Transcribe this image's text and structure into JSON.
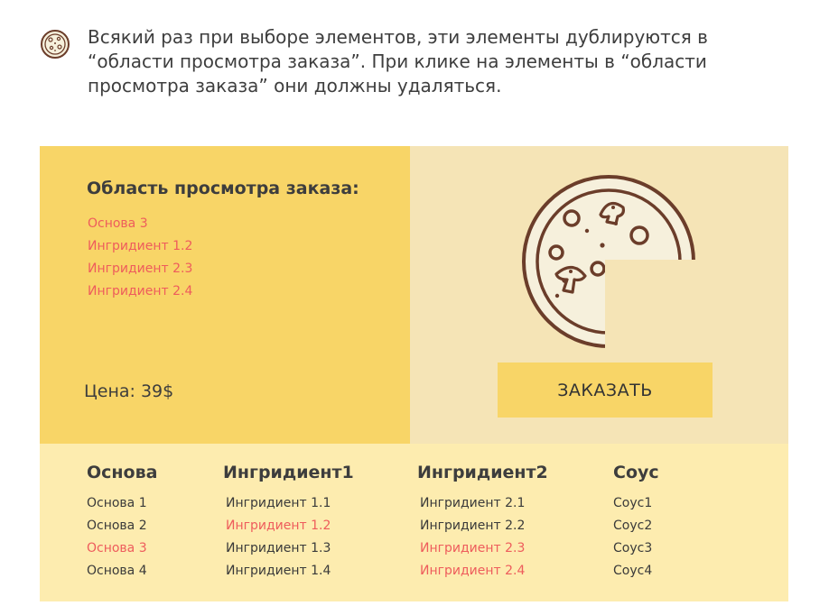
{
  "intro": {
    "icon": "pizza-icon",
    "text": "Всякий раз при выборе элементов, эти элементы дублируются в “области просмотра заказа”. При клике на элементы в “области просмотра заказа” они должны удаляться."
  },
  "preview": {
    "title": "Область просмотра заказа:",
    "items": [
      "Основа 3",
      "Ингридиент 1.2",
      "Ингридиент 2.3",
      "Ингридиент 2.4"
    ],
    "price": "Цена: 39$"
  },
  "pizza_panel": {
    "icon": "pizza-slice-missing-icon",
    "order_button": "ЗАКАЗАТЬ"
  },
  "options": {
    "columns": [
      {
        "title": "Основа",
        "items": [
          {
            "label": "Основа 1",
            "selected": false
          },
          {
            "label": "Основа 2",
            "selected": false
          },
          {
            "label": "Основа 3",
            "selected": true
          },
          {
            "label": "Основа 4",
            "selected": false
          }
        ]
      },
      {
        "title": "Ингридиент1",
        "items": [
          {
            "label": "Ингридиент 1.1",
            "selected": false
          },
          {
            "label": "Ингридиент 1.2",
            "selected": true
          },
          {
            "label": "Ингридиент 1.3",
            "selected": false
          },
          {
            "label": "Ингридиент 1.4",
            "selected": false
          }
        ]
      },
      {
        "title": "Ингридиент2",
        "items": [
          {
            "label": "Ингридиент 2.1",
            "selected": false
          },
          {
            "label": "Ингридиент 2.2",
            "selected": false
          },
          {
            "label": "Ингридиент 2.3",
            "selected": true
          },
          {
            "label": "Ингридиент 2.4",
            "selected": true
          }
        ]
      },
      {
        "title": "Соус",
        "items": [
          {
            "label": "Соус1",
            "selected": false
          },
          {
            "label": "Соус2",
            "selected": false
          },
          {
            "label": "Соус3",
            "selected": false
          },
          {
            "label": "Соус4",
            "selected": false
          }
        ]
      }
    ]
  },
  "colors": {
    "preview_bg": "#f8d567",
    "pizza_panel_bg": "#f5e4b6",
    "options_bg": "#fdecaf",
    "selected_text": "#ee5c5c",
    "pizza_outline": "#6b3d2a",
    "pizza_fill": "#f6f0dc"
  }
}
